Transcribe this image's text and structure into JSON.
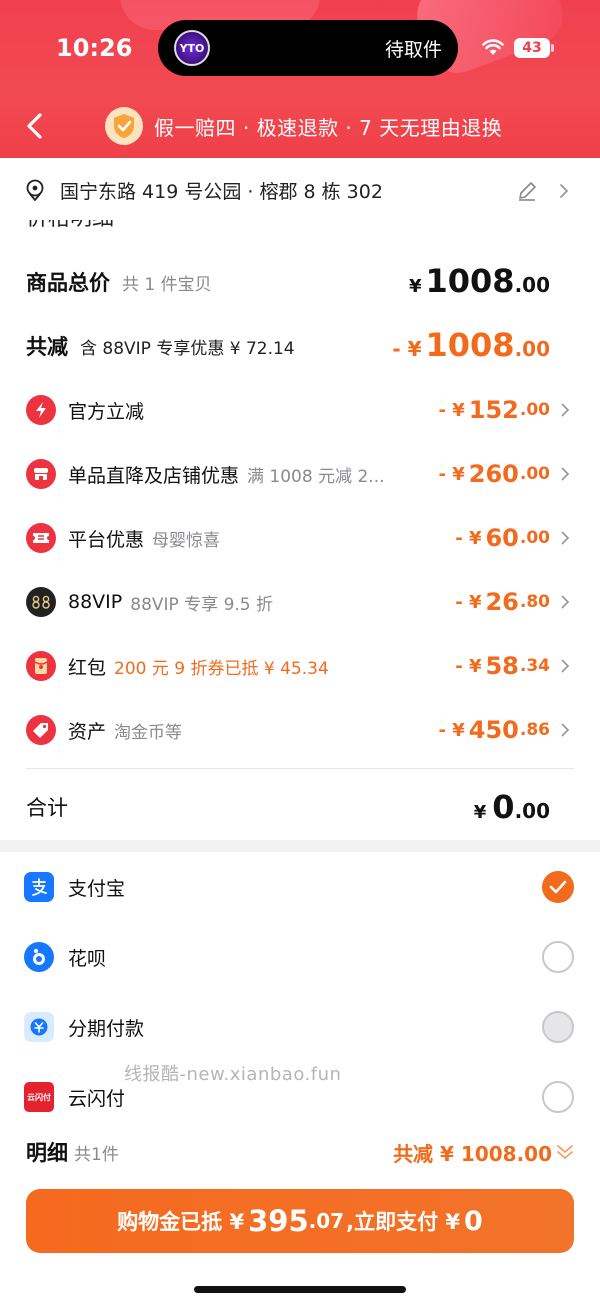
{
  "status_bar": {
    "time": "10:26",
    "island_label": "待取件",
    "island_logo": "YTO",
    "battery": "43"
  },
  "header": {
    "guarantee": "假一赔四 · 极速退款 · 7 天无理由退换"
  },
  "address": {
    "text": "国宁东路 419 号公园 · 榕郡 8 栋 302"
  },
  "price_section_title": "价格明细",
  "summary": {
    "goods_label": "商品总价",
    "goods_count": "共 1 件宝贝",
    "goods_prefix": "¥",
    "goods_int": "1008",
    "goods_dec": ".00",
    "reduce_label": "共减",
    "reduce_note": "含 88VIP 专享优惠 ¥ 72.14",
    "reduce_prefix": "- ¥",
    "reduce_int": "1008",
    "reduce_dec": ".00"
  },
  "discounts": [
    {
      "label": "官方立减",
      "sub": "",
      "sub_color": "",
      "prefix": "- ¥",
      "int": "152",
      "dec": ".00",
      "icon": "lightning-icon",
      "color": "#ee3340"
    },
    {
      "label": "单品直降及店铺优惠",
      "sub": "满 1008 元减 2...",
      "sub_color": "",
      "prefix": "- ¥",
      "int": "260",
      "dec": ".00",
      "icon": "shop-icon",
      "color": "#ee3340"
    },
    {
      "label": "平台优惠",
      "sub": "母婴惊喜",
      "sub_color": "",
      "prefix": "- ¥",
      "int": "60",
      "dec": ".00",
      "icon": "ticket-icon",
      "color": "#ee3340"
    },
    {
      "label": "88VIP",
      "sub": "88VIP 专享 9.5 折",
      "sub_color": "",
      "prefix": "- ¥",
      "int": "26",
      "dec": ".80",
      "icon": "vip88-icon",
      "color": "#222222"
    },
    {
      "label": "红包",
      "sub": "200 元 9 折券已抵 ¥ 45.34",
      "sub_color": "#f26b1d",
      "prefix": "- ¥",
      "int": "58",
      "dec": ".34",
      "icon": "red-envelope-icon",
      "color": "#ee3340"
    },
    {
      "label": "资产",
      "sub": "淘金币等",
      "sub_color": "",
      "prefix": "- ¥",
      "int": "450",
      "dec": ".86",
      "icon": "tag-icon",
      "color": "#ee3340"
    }
  ],
  "total": {
    "label": "合计",
    "prefix": "¥",
    "int": "0",
    "dec": ".00"
  },
  "payment_methods": [
    {
      "label": "支付宝",
      "icon": "alipay-icon",
      "state": "checked"
    },
    {
      "label": "花呗",
      "icon": "huabei-icon",
      "state": "unchecked"
    },
    {
      "label": "分期付款",
      "icon": "installment-icon",
      "state": "disabled"
    },
    {
      "label": "云闪付",
      "icon": "unionpay-icon",
      "state": "unchecked"
    }
  ],
  "unionpay_icon_text": "云闪付",
  "watermark": "线报酷-new.xianbao.fun",
  "detail": {
    "title": "明细",
    "count": "共1件",
    "reduce": "共减 ¥ 1008.00"
  },
  "pay_button": {
    "part1": "购物金已抵 ¥",
    "part2": "395",
    "part3": ".07",
    "part4": ",立即支付 ¥",
    "part5": "0"
  },
  "colors": {
    "header_red": "#f0404f",
    "accent_orange": "#f26b1d",
    "alipay_blue": "#1677ff"
  }
}
